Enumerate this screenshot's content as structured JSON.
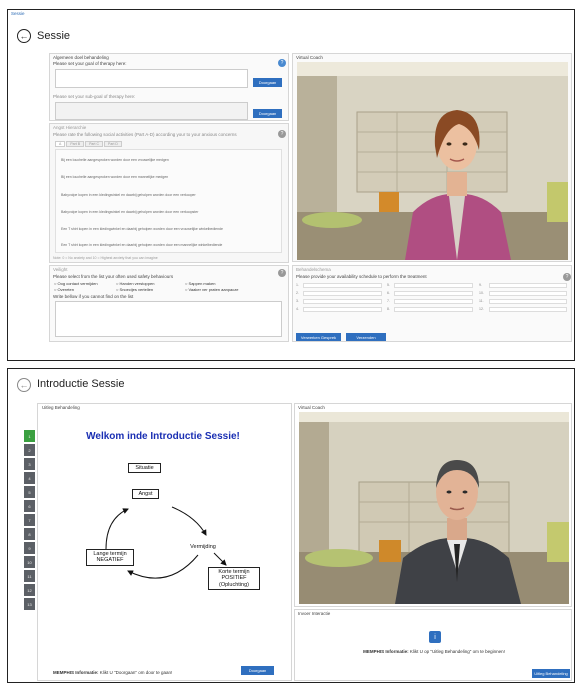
{
  "screen1": {
    "window_title": "Sessie",
    "title": "Sessie",
    "goal_panel": {
      "header": "Algemeen doel behandeling",
      "goal_label": "Please set your goal of therapy here:",
      "goal_button": "Doorgaan",
      "subgoal_label": "Please set your sub-goal of therapy here:",
      "subgoal_button": "Doorgaan"
    },
    "anxiety_panel": {
      "header": "Angst Hierarchie",
      "instruction": "Please rate the following social activities (Part A-D) according your to your anxious concerns",
      "tabs": [
        "A",
        "Part B",
        "Part C",
        "Part D"
      ],
      "items": [
        "Bij een louchelle aangesproken worden door een vrouwelijke medgen",
        "Bij een louchelle aangesproken worden door een mannelijke medgen",
        "Babyvolpe kopen in een kledingwinkel en daarbij geholpen worden door een verkooper",
        "Babyvolpe kopen in een kledingwinkel en daarbij geholpen worden door een verkoopster",
        "Een T shirt kopen in een kledingwinkel en daarbij geholpen worden door een vrouwelijke winkelbediende",
        "Een T shirt kopen in een kledingwinkel en daarbij geholpen worden door een mannelijke winkelbediende"
      ],
      "note": "Note: 0 = No anxiety and 10 = Highest anxiety that you can imagine"
    },
    "safety_panel": {
      "header": "Veilight",
      "instruction": "Please select from the list your often used safety behaviours",
      "options": [
        "Oog contact vermijden",
        "Handen verstoppen",
        "Sappen maken",
        "Overeten",
        "Snoecijes vertellen",
        "Vaaker ver praten aanpacze"
      ],
      "other_label": "Write bellow if you cannot find on the list"
    },
    "coach_label": "Virtual Coach",
    "schedule_panel": {
      "header": "Behandelschema",
      "instruction": "Please provide your availability schedule to perform the treatment",
      "slots": [
        "1.",
        "2.",
        "3.",
        "4.",
        "5.",
        "6.",
        "7.",
        "8.",
        "9.",
        "10.",
        "11.",
        "12."
      ],
      "button_one": "Verwerken Gesprek",
      "button_two": "Verzenden"
    }
  },
  "screen2": {
    "title": "Introductie Sessie",
    "left_label": "Uitleg Behandeling",
    "nav_items": [
      "1",
      "2",
      "3",
      "4",
      "5",
      "6",
      "7",
      "8",
      "9",
      "10",
      "11",
      "12",
      "13"
    ],
    "heading": "Welkom inde Introductie Sessie!",
    "diagram": {
      "situatie": "Situatie",
      "angst": "Angst",
      "vermijding": "Vermijding",
      "lange_line1": "Lange termijn",
      "lange_line2": "NEGATIEF",
      "korte_line1": "Korte termijn",
      "korte_line2": "POSITIEF",
      "korte_line3": "(Opluchting)"
    },
    "footer_info_bold": "MEMPHIS Informatie:",
    "footer_info_text": "Klikt U \"Doorgaan\" om door te gaan!",
    "footer_button": "Doorgaan",
    "coach_label": "Virtual Coach",
    "interaction_label": "Invoer Interactie",
    "interaction_info_bold": "MEMPHIS Informatie:",
    "interaction_info_text": "Klikt U op \"Uitleg Behandeling\" om te beginnen!",
    "interaction_button": "Uitleg Behandeling"
  }
}
